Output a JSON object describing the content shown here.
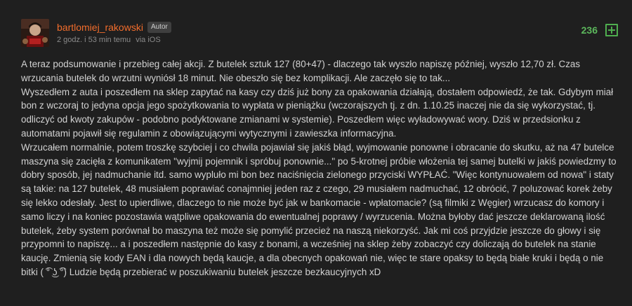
{
  "author": {
    "name": "bartlomiej_rakowski",
    "badge": "Autor",
    "avatar": "avatar-image"
  },
  "meta": {
    "time": "2 godz. i 53 min temu",
    "via": "via iOS"
  },
  "votes": {
    "count": "236",
    "plus_icon": "plus-icon"
  },
  "colors": {
    "background": "#1f1f1f",
    "author": "#f26d2c",
    "votes": "#5cb85c",
    "text": "#d2d2d2"
  },
  "body": {
    "paragraphs": [
      "A teraz podsumowanie i przebieg całej akcji. Z butelek sztuk 127 (80+47) - dlaczego tak wyszło napiszę później, wyszło 12,70 zł. Czas wrzucania butelek do wrzutni wyniósł 18 minut. Nie obeszło się bez komplikacji. Ale zaczęło się to tak...",
      "Wyszedłem z auta i poszedłem na sklep zapytać na kasy czy dziś już bony za opakowania działają, dostałem odpowiedź, że tak. Gdybym miał bon z wczoraj to jedyna opcja jego spożytkowania to wypłata w pieniążku (wczorajszych tj. z dn. 1.10.25 inaczej nie da się wykorzystać, tj. odliczyć od kwoty zakupów - podobno podyktowane zmianami w systemie). Poszedłem więc wyładowywać wory. Dziś w przedsionku z automatami pojawił się regulamin z obowiązującymi wytycznymi i zawieszka informacyjna.",
      "Wrzucałem normalnie, potem troszkę szybciej i co chwila pojawiał się jakiś błąd, wyjmowanie ponowne i obracanie do skutku, aż na 47 butelce maszyna się zacięła z komunikatem \"wyjmij pojemnik i spróbuj ponownie...\" po 5-krotnej próbie włożenia tej samej butelki w jakiś powiedzmy to dobry sposób, jej nadmuchanie itd. samo wypluło mi bon bez naciśnięcia zielonego przyciski WYPŁAĆ. \"Więc kontynuowałem od nowa\" i staty są takie: na 127 butelek, 48 musiałem poprawiać conajmniej jeden raz z czego, 29 musiałem nadmuchać, 12 obrócić, 7 poluzować korek żeby się lekko odesłały. Jest to upierdliwe, dlaczego to nie może być jak w bankomacie - wpłatomacie? (są filmiki z Węgier) wrzucasz do komory i samo liczy i na koniec pozostawia wątpliwe opakowania do ewentualnej poprawy / wyrzucenia. Można byłoby dać jeszcze deklarowaną ilość butelek, żeby system porównał bo maszyna też może się pomylić przecież na naszą niekorzyść. Jak mi coś przyjdzie jeszcze do głowy i się przypomni to napiszę... a i poszedłem następnie do kasy z bonami, a wcześniej na sklep żeby zobaczyć czy doliczają do butelek na stanie kaucję. Zmienią się kody EAN i dla nowych będą kaucje, a dla obecnych opakowań nie, więc te stare opaksy to będą białe kruki i będą o nie bitki ( ͡° ͜ʖ ͡°) Ludzie będą przebierać w poszukiwaniu butelek jeszcze bezkaucyjnych xD"
    ]
  }
}
